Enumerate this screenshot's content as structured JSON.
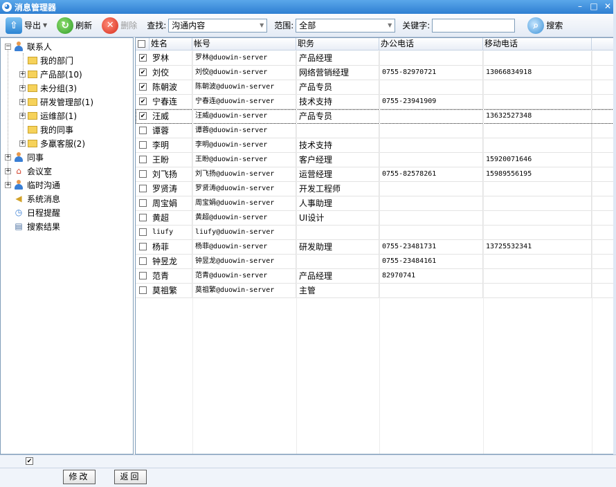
{
  "window": {
    "title": "消息管理器"
  },
  "toolbar": {
    "export_label": "导出",
    "refresh_label": "刷新",
    "delete_label": "删除",
    "find_label": "查找:",
    "find_value": "沟通内容",
    "scope_label": "范围:",
    "scope_value": "全部",
    "keyword_label": "关键字:",
    "keyword_value": "",
    "search_label": "搜索"
  },
  "tree": {
    "contacts": "联系人",
    "children": [
      {
        "label": "我的部门",
        "expandable": false
      },
      {
        "label": "产品部(10)",
        "expandable": true
      },
      {
        "label": "未分组(3)",
        "expandable": true
      },
      {
        "label": "研发管理部(1)",
        "expandable": true
      },
      {
        "label": "运维部(1)",
        "expandable": true
      },
      {
        "label": "我的同事",
        "expandable": false
      },
      {
        "label": "多羸客服(2)",
        "expandable": true
      }
    ],
    "colleagues": "同事",
    "meeting_room": "会议室",
    "temp_chat": "临时沟通",
    "system_msg": "系统消息",
    "schedule": "日程提醒",
    "search_results": "搜索结果"
  },
  "grid": {
    "columns": [
      "姓名",
      "帐号",
      "职务",
      "办公电话",
      "移动电话"
    ],
    "rows": [
      {
        "checked": true,
        "name": "罗林",
        "account": "罗林@duowin-server",
        "title": "产品经理",
        "office": "",
        "mobile": ""
      },
      {
        "checked": true,
        "name": "刘佼",
        "account": "刘佼@duowin-server",
        "title": "网络营销经理",
        "office": "0755-82970721",
        "mobile": "13066834918"
      },
      {
        "checked": true,
        "name": "陈朝波",
        "account": "陈朝波@duowin-server",
        "title": "产品专员",
        "office": "",
        "mobile": ""
      },
      {
        "checked": true,
        "name": "宁春连",
        "account": "宁春连@duowin-server",
        "title": "技术支持",
        "office": "0755-23941909",
        "mobile": ""
      },
      {
        "checked": true,
        "name": "汪威",
        "account": "汪威@duowin-server",
        "title": "产品专员",
        "office": "",
        "mobile": "13632527348"
      },
      {
        "checked": false,
        "name": "谭蓉",
        "account": "谭蓉@duowin-server",
        "title": "",
        "office": "",
        "mobile": ""
      },
      {
        "checked": false,
        "name": "李明",
        "account": "李明@duowin-server",
        "title": "技术支持",
        "office": "",
        "mobile": ""
      },
      {
        "checked": false,
        "name": "王盼",
        "account": "王盼@duowin-server",
        "title": "客户经理",
        "office": "",
        "mobile": "15920071646"
      },
      {
        "checked": false,
        "name": "刘飞扬",
        "account": "刘飞扬@duowin-server",
        "title": "运营经理",
        "office": "0755-82578261",
        "mobile": "15989556195"
      },
      {
        "checked": false,
        "name": "罗贤涛",
        "account": "罗贤涛@duowin-server",
        "title": "开发工程师",
        "office": "",
        "mobile": ""
      },
      {
        "checked": false,
        "name": "周宝娟",
        "account": "周宝娟@duowin-server",
        "title": "人事助理",
        "office": "",
        "mobile": ""
      },
      {
        "checked": false,
        "name": "黄超",
        "account": "黄超@duowin-server",
        "title": "UI设计",
        "office": "",
        "mobile": ""
      },
      {
        "checked": false,
        "name": "liufy",
        "account": "liufy@duowin-server",
        "title": "",
        "office": "",
        "mobile": ""
      },
      {
        "checked": false,
        "name": "杨菲",
        "account": "杨菲@duowin-server",
        "title": "研发助理",
        "office": "0755-23481731",
        "mobile": "13725532341"
      },
      {
        "checked": false,
        "name": "钟昱龙",
        "account": "钟昱龙@duowin-server",
        "title": "",
        "office": "0755-23484161",
        "mobile": ""
      },
      {
        "checked": false,
        "name": "范青",
        "account": "范青@duowin-server",
        "title": "产品经理",
        "office": "82970741",
        "mobile": ""
      },
      {
        "checked": false,
        "name": "莫祖繁",
        "account": "莫祖繁@duowin-server",
        "title": "主管",
        "office": "",
        "mobile": ""
      }
    ]
  },
  "footer": {
    "modify_label": "修改",
    "back_label": "返回"
  }
}
